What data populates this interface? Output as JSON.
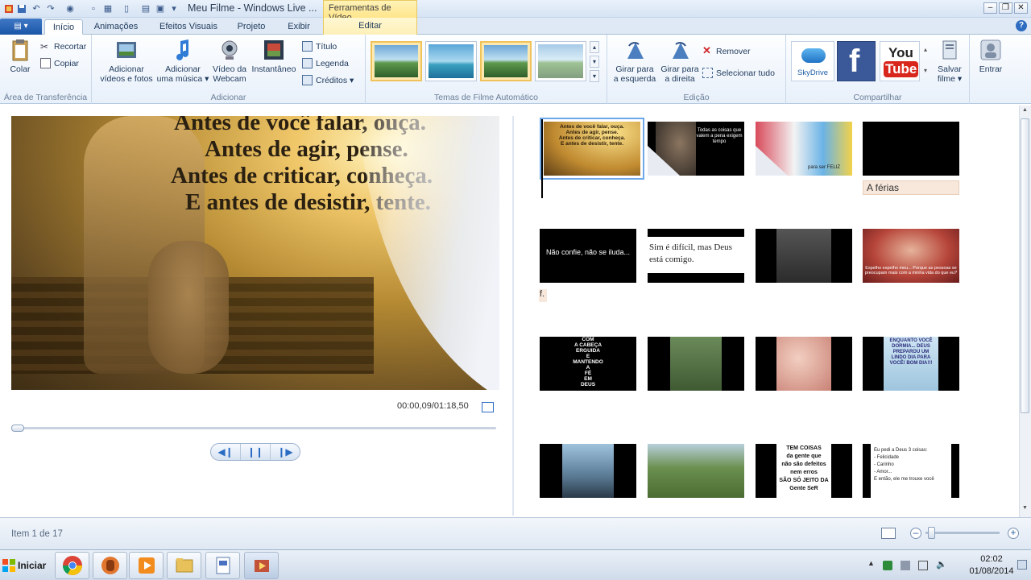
{
  "window": {
    "title": "Meu Filme - Windows Live ...",
    "contextual_group": "Ferramentas de Vídeo"
  },
  "tabs": {
    "app_menu": "▤ ▾",
    "items": [
      "Início",
      "Animações",
      "Efeitos Visuais",
      "Projeto",
      "Exibir"
    ],
    "contextual_tab": "Editar"
  },
  "ribbon": {
    "clipboard": {
      "label": "Área de Transferência",
      "paste": "Colar",
      "cut": "Recortar",
      "copy": "Copiar"
    },
    "add": {
      "label": "Adicionar",
      "add_videos": [
        "Adicionar",
        "vídeos e fotos"
      ],
      "add_music": [
        "Adicionar",
        "uma música ▾"
      ],
      "webcam": [
        "Vídeo da",
        "Webcam"
      ],
      "snapshot": "Instantâneo",
      "title": "Título",
      "caption": "Legenda",
      "credits": "Créditos ▾"
    },
    "themes": {
      "label": "Temas de Filme Automático"
    },
    "edit": {
      "label": "Edição",
      "rotate_left": [
        "Girar para",
        "a esquerda"
      ],
      "rotate_right": [
        "Girar para",
        "a direita"
      ],
      "remove": "Remover",
      "select_all": "Selecionar tudo"
    },
    "share": {
      "label": "Compartilhar",
      "skydrive": "SkyDrive",
      "youtube_you": "You",
      "youtube_tube": "Tube",
      "save_movie": [
        "Salvar",
        "filme ▾"
      ]
    },
    "signin": {
      "label": "Entrar"
    }
  },
  "preview": {
    "lines": [
      "Antes de você falar, ouça.",
      "Antes de agir, pense.",
      "Antes de criticar, conheça.",
      "E antes de desistir, tente."
    ],
    "timecode": "00:00,09/01:18,50"
  },
  "storyboard": {
    "clip1_text": "Antes de você falar, ouça.\nAntes de agir, pense.\nAntes de criticar, conheça.\nE antes de desistir, tente.",
    "clip2_text": "Todas as coisas que valem a pena exigem tempo",
    "clip3_text": "para ser FELIZ",
    "caption_ferias": "A férias",
    "clip5_text": "Não confie, não se iluda...",
    "caption_f": "f.",
    "clip6_text": "Sim é difícil, mas Deus está comigo.",
    "clip8_text": "Espelho espelho meu... Porque as pessoas se preocupam mais com a minha vida do que eu?",
    "clip9_lines": [
      "COM",
      "A CABEÇA",
      "ERGUIDA",
      "E",
      "MANTENDO",
      "A",
      "FÉ",
      "EM",
      "DEUS"
    ],
    "clip12_text": "ENQUANTO VOCÊ DORMIA... DEUS PREPAROU UM LINDO DIA PARA VOCÊ! BOM DIA!!!",
    "clip15_lines": [
      "TEM COISAS",
      "da gente que",
      "não são defeitos",
      "nem erros",
      "SÃO SÓ JEITO DA",
      "Gente SeR"
    ],
    "clip16_lines": [
      "Eu pedi a Deus 3 coisas:",
      "- Felicidade",
      "- Carinho",
      "- Amor...",
      "E então, ele me trouxe você"
    ]
  },
  "status": {
    "text": "Item 1 de 17"
  },
  "taskbar": {
    "start": "Iniciar",
    "clock_time": "02:02",
    "clock_date": "01/08/2014"
  },
  "colors": {
    "accent": "#2a6bc3",
    "selection": "#6ea8e8",
    "contextual": "#ffe58a"
  }
}
